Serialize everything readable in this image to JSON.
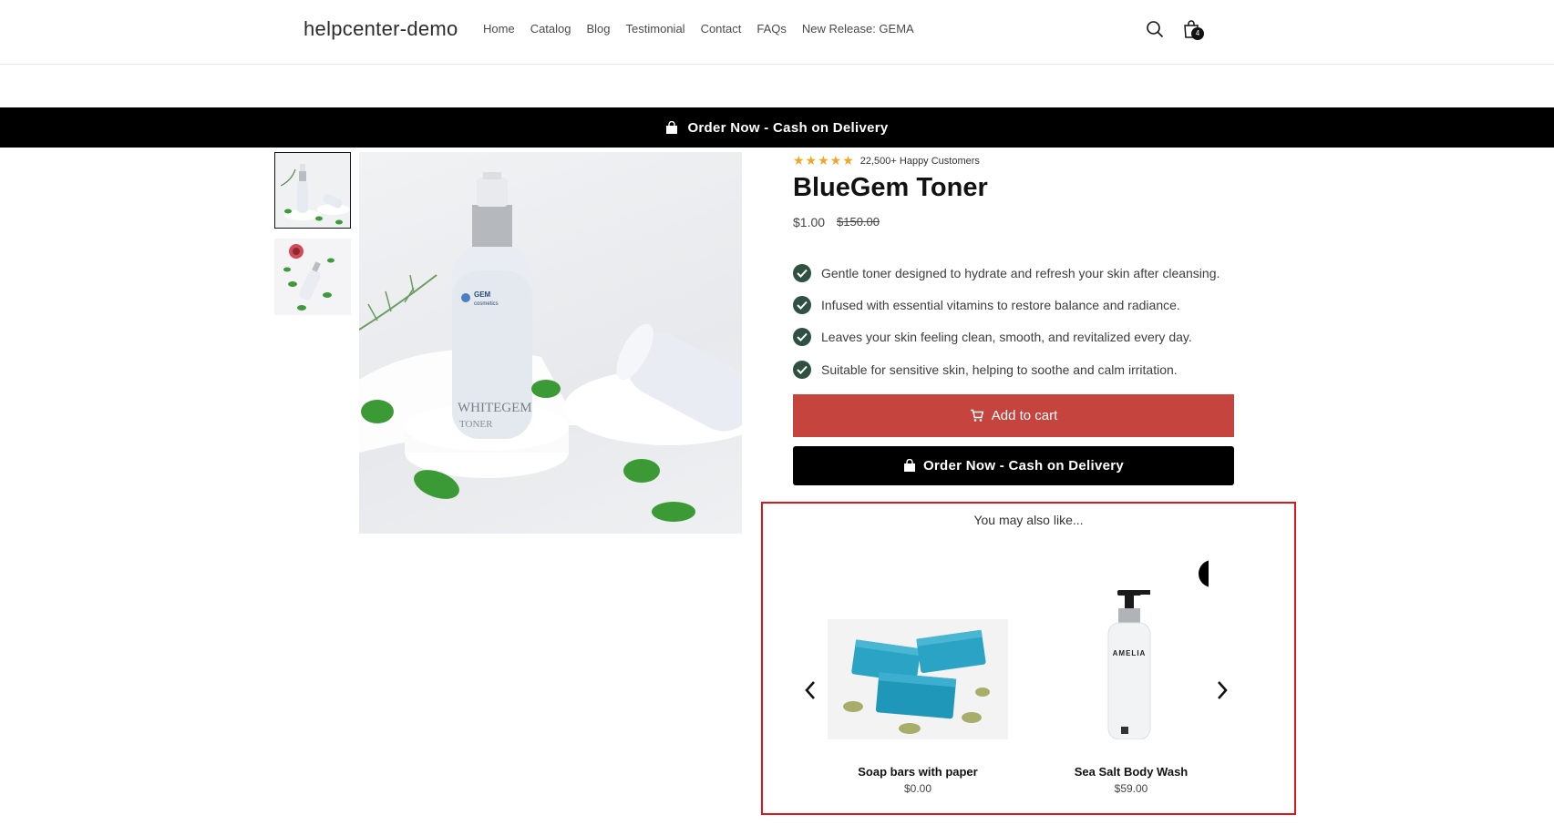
{
  "header": {
    "logo": "helpcenter-demo",
    "nav": [
      "Home",
      "Catalog",
      "Blog",
      "Testimonial",
      "Contact",
      "FAQs",
      "New Release: GEMA"
    ],
    "cart_count": "4",
    "search_icon": "search-icon",
    "cart_icon": "shopping-bag-icon"
  },
  "announcement": {
    "text": "Order Now - Cash on Delivery",
    "icon": "shopping-bag-icon"
  },
  "product": {
    "rating_stars": 5,
    "rating_text": "22,500+ Happy Customers",
    "title": "BlueGem Toner",
    "price": "$1.00",
    "compare_price": "$150.00",
    "image_text": {
      "brand": "GEM",
      "brand_sub": "cosmetics",
      "bottle_name": "WHITEGEM",
      "bottle_type": "TONER"
    },
    "benefits": [
      "Gentle toner designed to hydrate and refresh your skin after cleansing.",
      "Infused with essential vitamins to restore balance and radiance.",
      "Leaves your skin feeling clean, smooth, and revitalized every day.",
      "Suitable for sensitive skin, helping to soothe and calm irritation."
    ],
    "add_to_cart_label": "Add to cart",
    "order_now_label": "Order Now - Cash on Delivery"
  },
  "recommendations": {
    "title": "You may also like...",
    "items": [
      {
        "name": "Soap bars with paper",
        "price": "$0.00"
      },
      {
        "name": "Sea Salt Body Wash",
        "price": "$59.00",
        "label": "AMELIA"
      }
    ]
  },
  "colors": {
    "announce_bg": "#000000",
    "add_to_cart_bg": "#c5443e",
    "check_bg": "#2e5142",
    "star": "#f4a623",
    "highlight_border": "#e1141c"
  }
}
